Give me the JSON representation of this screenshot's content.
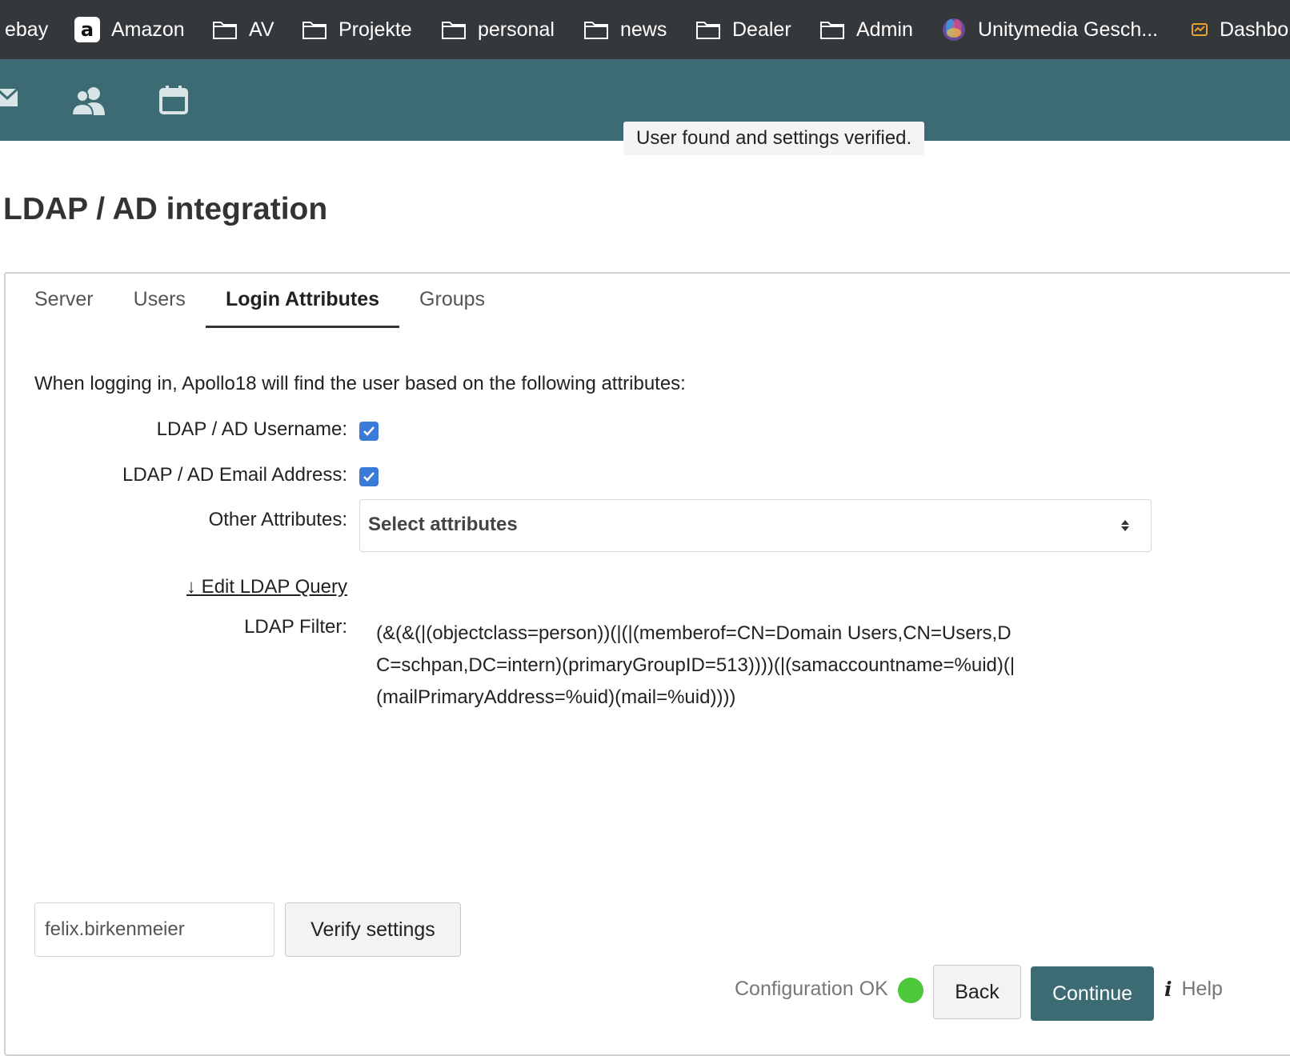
{
  "bookmarks": {
    "items": [
      {
        "label": "ebay"
      },
      {
        "label": "Amazon",
        "icon": "amazon-logo"
      },
      {
        "label": "AV",
        "icon": "folder-icon"
      },
      {
        "label": "Projekte",
        "icon": "folder-icon"
      },
      {
        "label": "personal",
        "icon": "folder-icon"
      },
      {
        "label": "news",
        "icon": "folder-icon"
      },
      {
        "label": "Dealer",
        "icon": "folder-icon"
      },
      {
        "label": "Admin",
        "icon": "folder-icon"
      },
      {
        "label": "Unitymedia Gesch...",
        "icon": "unitymedia-icon"
      },
      {
        "label": "Dashbo",
        "icon": "dashboard-icon"
      }
    ]
  },
  "header": {
    "icons": [
      "mail-icon",
      "users-icon",
      "calendar-icon"
    ],
    "toast": "User found and settings verified.",
    "background": "#3c6b74"
  },
  "page": {
    "title": "LDAP / AD integration"
  },
  "tabs": [
    {
      "label": "Server",
      "active": false
    },
    {
      "label": "Users",
      "active": false
    },
    {
      "label": "Login Attributes",
      "active": true
    },
    {
      "label": "Groups",
      "active": false
    }
  ],
  "login_attributes": {
    "intro": "When logging in, Apollo18 will find the user based on the following attributes:",
    "username_label": "LDAP / AD Username:",
    "username_checked": true,
    "email_label": "LDAP / AD Email Address:",
    "email_checked": true,
    "other_label": "Other Attributes:",
    "other_placeholder": "Select attributes",
    "edit_query_link": "↓ Edit LDAP Query",
    "filter_label": "LDAP Filter:",
    "filter_value": "(&(&(|(objectclass=person))(|(|(memberof=CN=Domain Users,CN=Users,DC=schpan,DC=intern)(primaryGroupID=513))))(|(samaccountname=%uid)(|(mailPrimaryAddress=%uid)(mail=%uid))))"
  },
  "footer": {
    "test_user_value": "felix.birkenmeier",
    "verify_label": "Verify settings",
    "status_text": "Configuration OK",
    "status_color": "#4cc83a",
    "back_label": "Back",
    "continue_label": "Continue",
    "help_label": "Help"
  }
}
